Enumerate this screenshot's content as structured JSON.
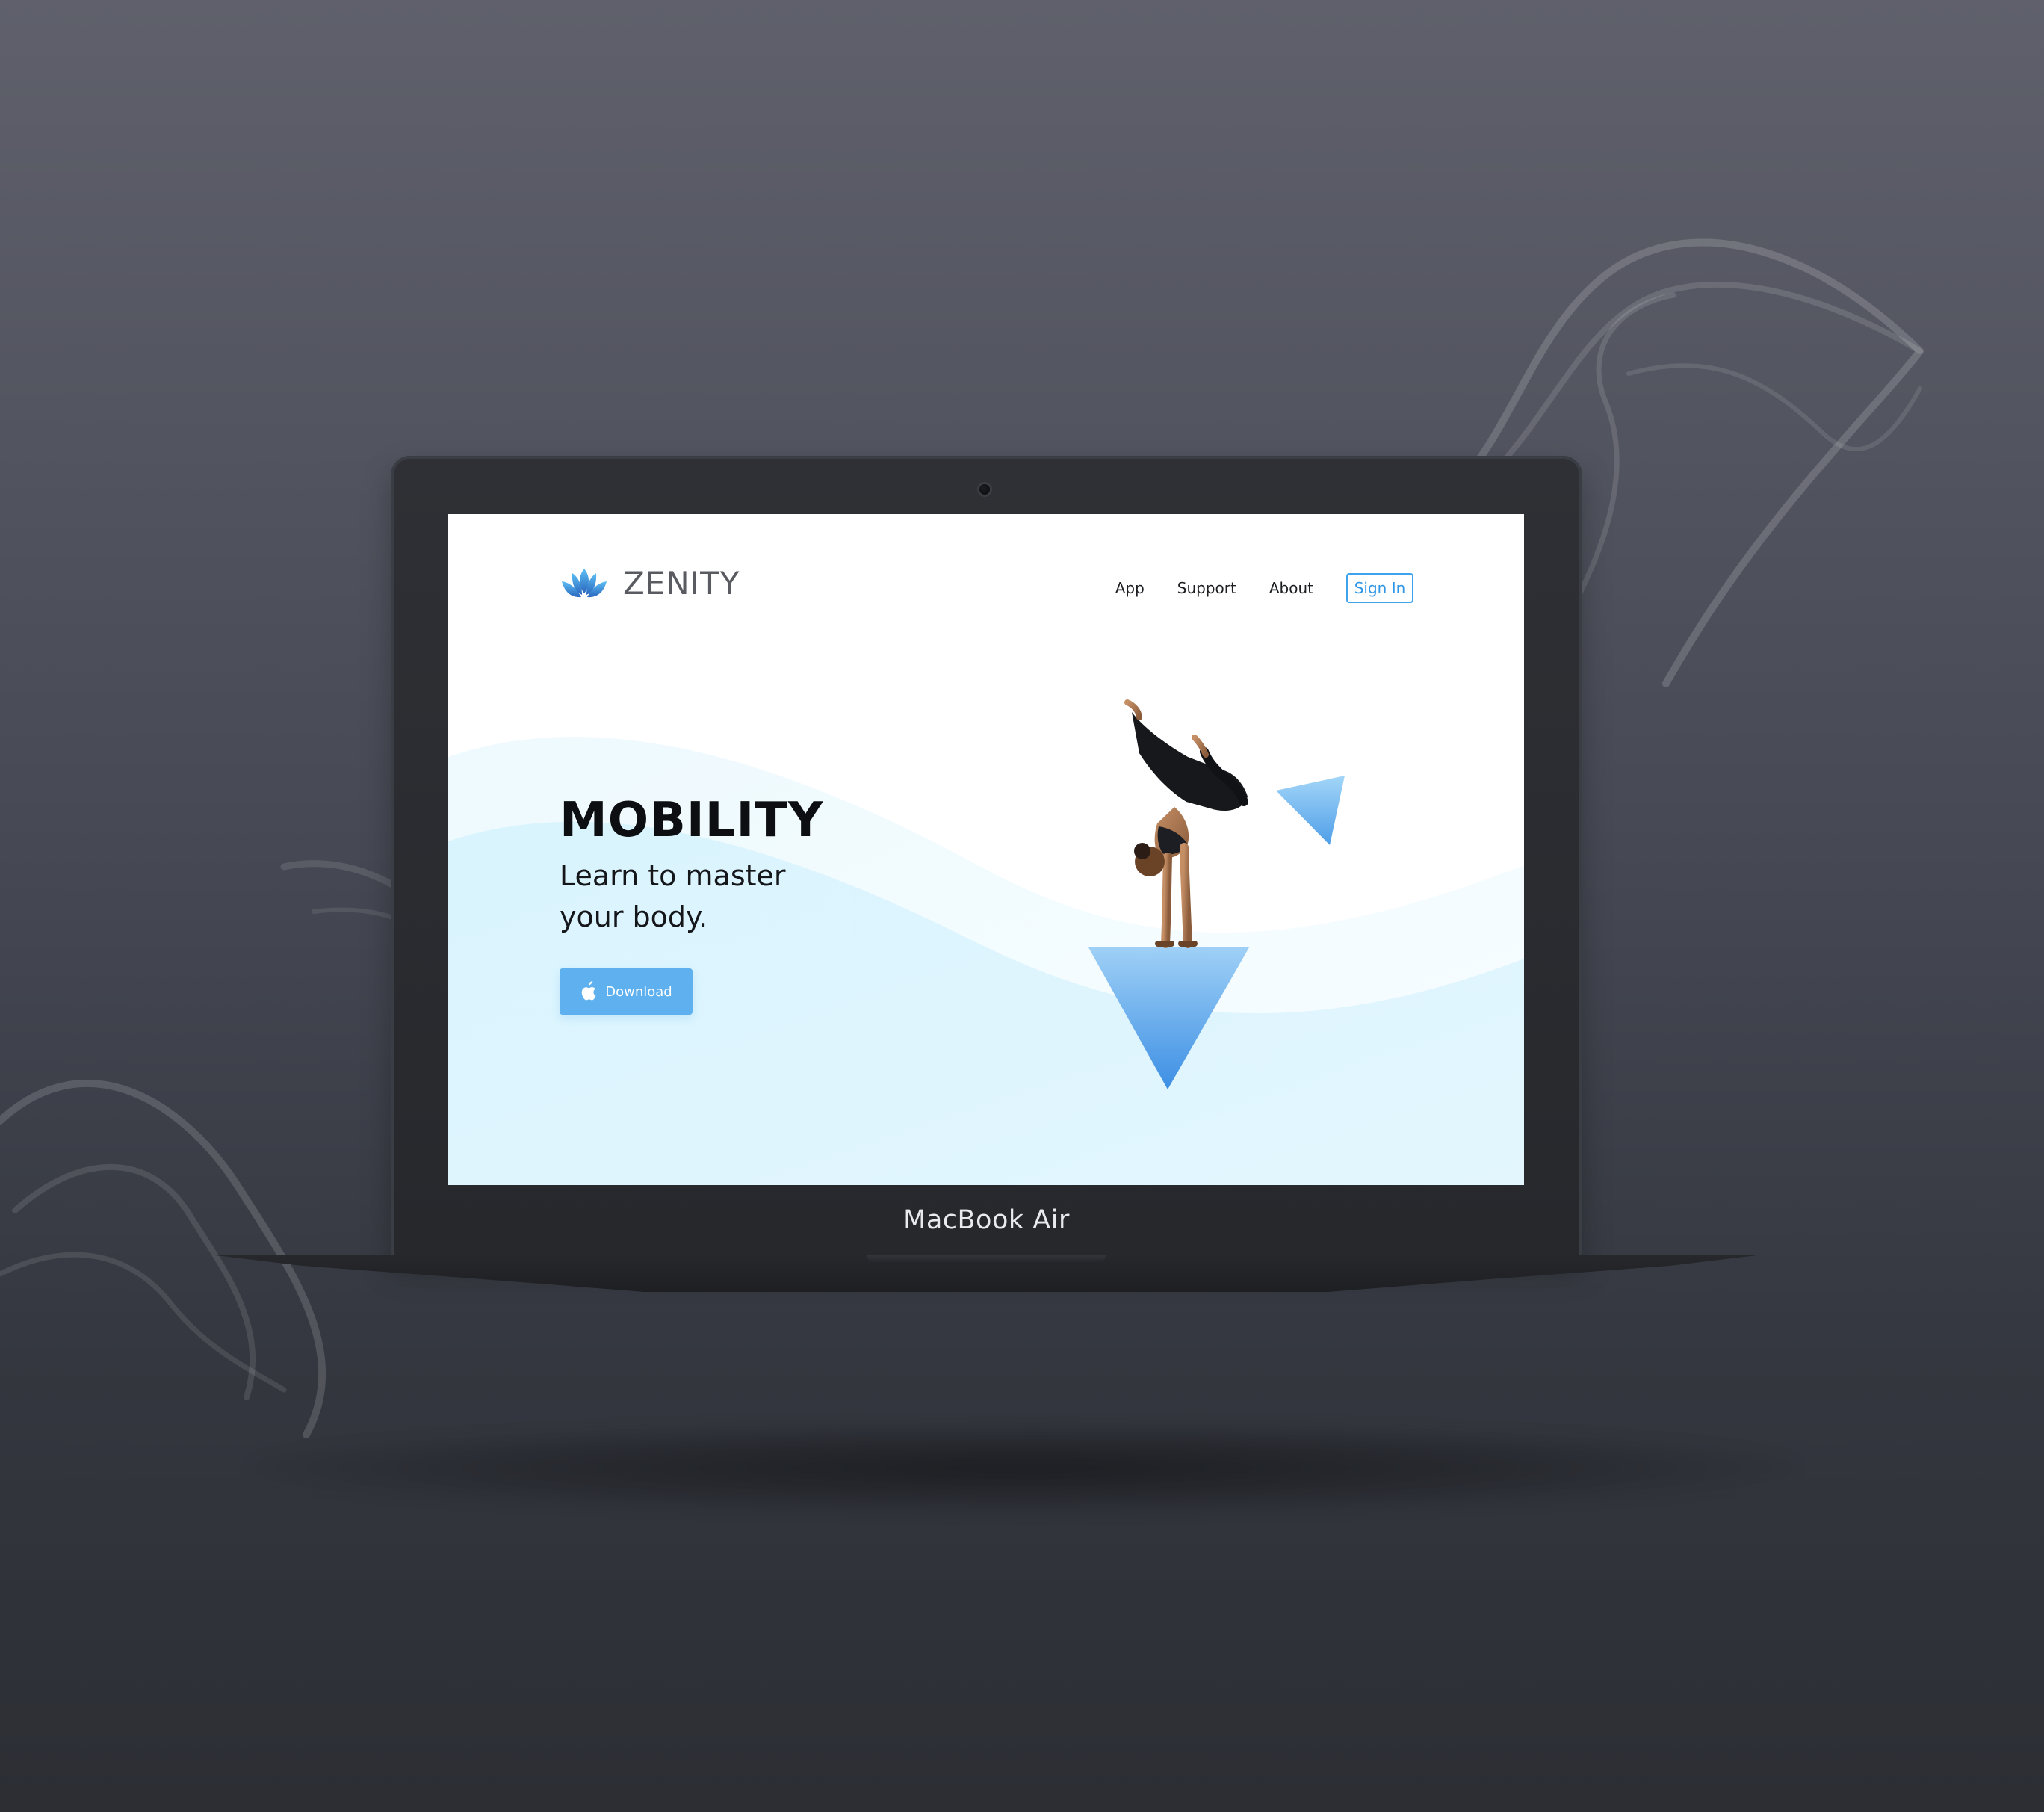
{
  "brand": {
    "name": "ZENITY",
    "logo_icon": "lotus-icon"
  },
  "nav": {
    "items": [
      "App",
      "Support",
      "About"
    ],
    "sign_in": "Sign In"
  },
  "hero": {
    "title": "MOBILITY",
    "subtitle_line_1": "Learn to master",
    "subtitle_line_2": "your body.",
    "download_label": "Download",
    "download_icon": "apple-icon"
  },
  "device": {
    "label": "MacBook Air"
  },
  "colors": {
    "accent": "#3ea2ec",
    "button": "#5fb0ee",
    "wave_light": "#eaf8ff",
    "wave_main": "#d7f3fd",
    "triangle_top": "#9bd0f5",
    "triangle_bottom": "#3d95e4"
  }
}
